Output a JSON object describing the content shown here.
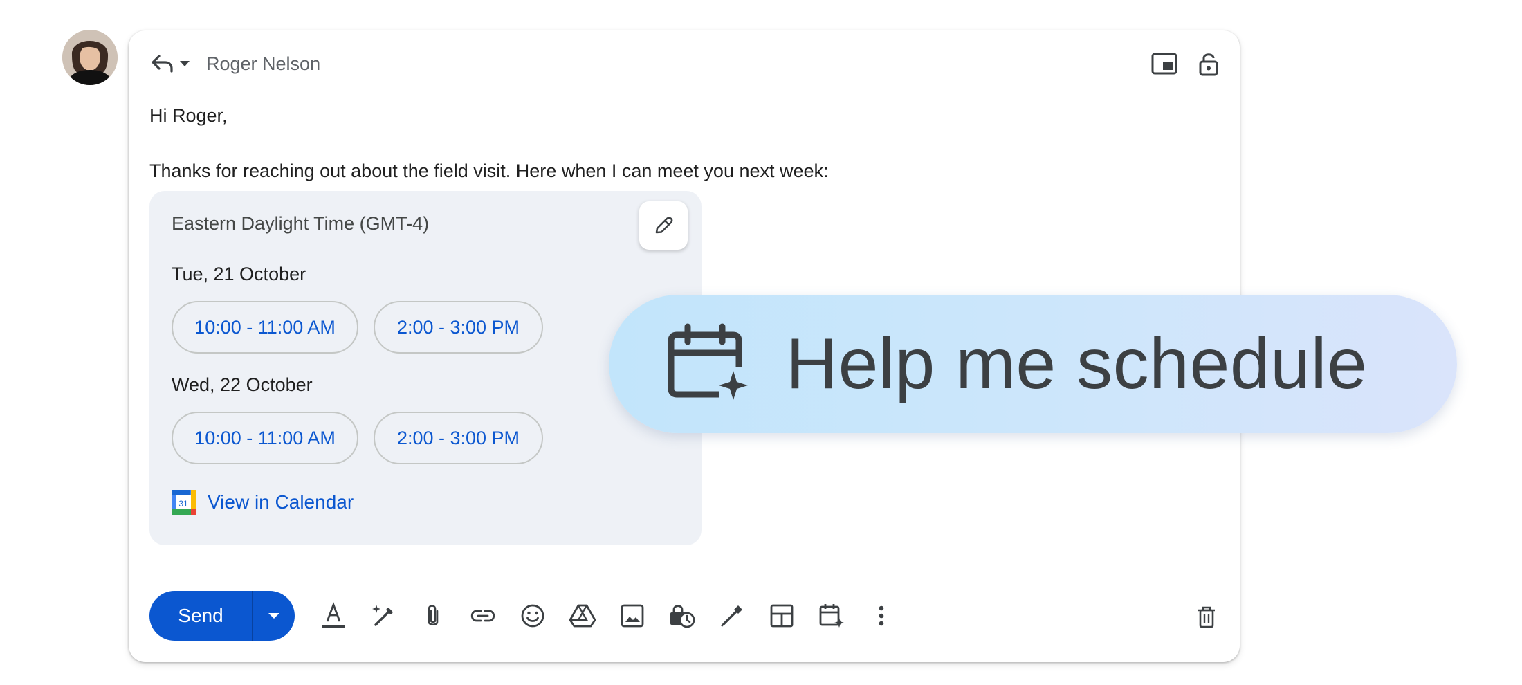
{
  "avatar": {
    "alt": "User avatar"
  },
  "compose": {
    "recipient": "Roger Nelson",
    "greeting": "Hi Roger,",
    "message": "Thanks for reaching out about the field visit. Here when I can meet you next week:"
  },
  "schedule_card": {
    "timezone": "Eastern Daylight Time (GMT-4)",
    "days": [
      {
        "label": "Tue, 21 October",
        "slots": [
          "10:00 - 11:00 AM",
          "2:00 - 3:00 PM"
        ]
      },
      {
        "label": "Wed, 22 October",
        "slots": [
          "10:00 - 11:00 AM",
          "2:00 - 3:00 PM"
        ]
      }
    ],
    "calendar_link": "View in Calendar",
    "calendar_icon_day": "31"
  },
  "toolbar": {
    "send_label": "Send",
    "tools": [
      "formatting-options-icon",
      "help-me-write-icon",
      "attach-file-icon",
      "insert-link-icon",
      "insert-emoji-icon",
      "insert-drive-icon",
      "insert-photo-icon",
      "confidential-mode-icon",
      "insert-signature-icon",
      "layouts-icon",
      "schedule-icon",
      "more-options-icon"
    ]
  },
  "callout": {
    "label": "Help me schedule"
  },
  "colors": {
    "accent": "#0b57d0",
    "card_bg": "#eef1f6"
  }
}
